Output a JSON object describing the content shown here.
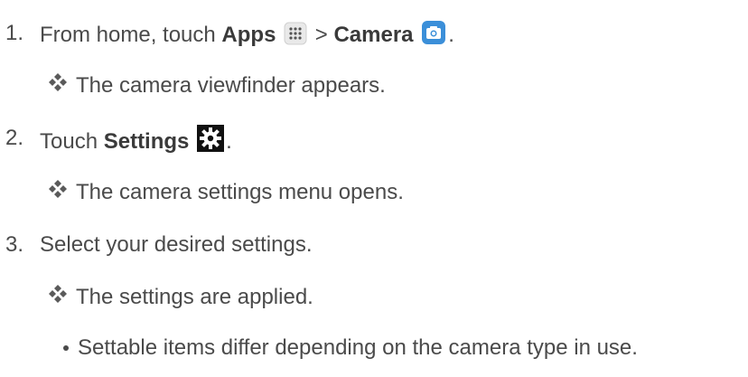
{
  "steps": [
    {
      "number": "1.",
      "pre": "From home, touch",
      "bold1": "Apps",
      "sep": ">",
      "bold2": "Camera",
      "post": ".",
      "result": "The camera viewfinder appears."
    },
    {
      "number": "2.",
      "pre": "Touch",
      "bold1": "Settings",
      "post": ".",
      "result": "The camera settings menu opens."
    },
    {
      "number": "3.",
      "pre": "Select your desired settings.",
      "result": "The settings are applied."
    }
  ],
  "bullet": "Settable items differ depending on the camera type in use.",
  "icons": {
    "apps": "apps-grid-icon",
    "camera": "camera-app-icon",
    "settings": "gear-icon",
    "result": "four-diamond-icon"
  },
  "colors": {
    "text": "#4a4a4a",
    "camera_blue": "#3b8fd9",
    "settings_bg": "#111111"
  }
}
